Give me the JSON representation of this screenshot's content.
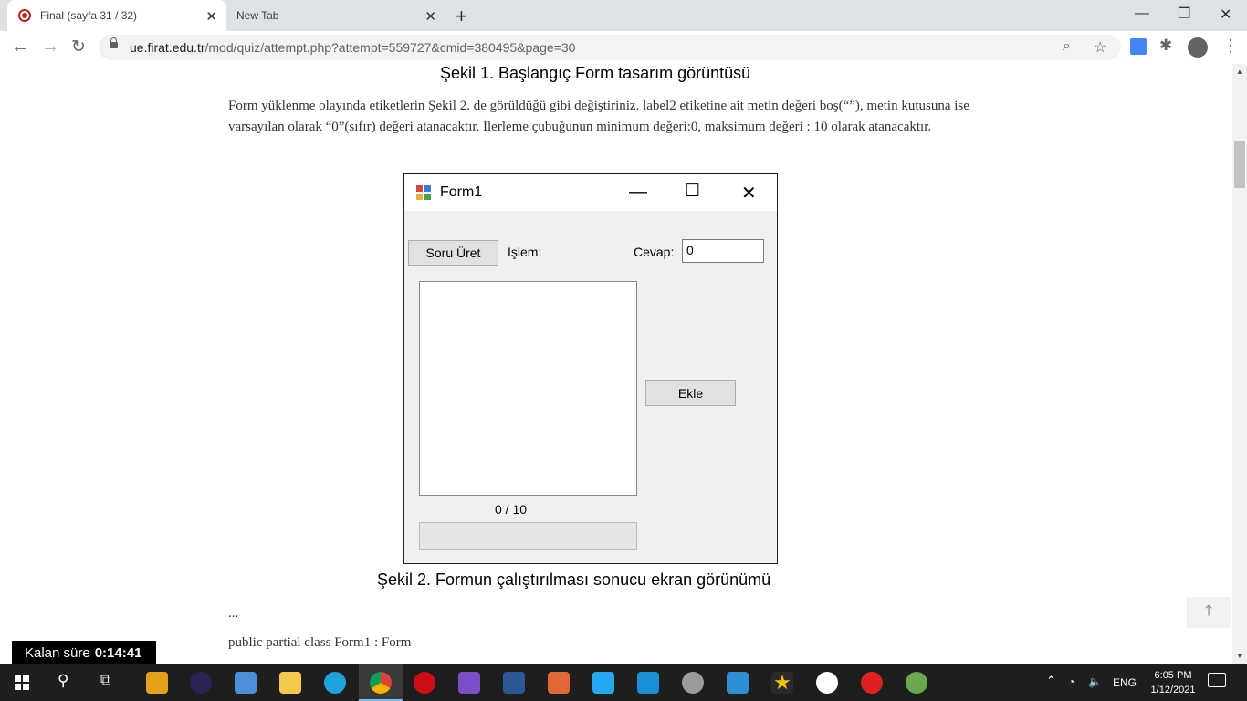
{
  "browser": {
    "tabs": [
      {
        "title": "Final (sayfa 31 / 32)",
        "active": true
      },
      {
        "title": "New Tab",
        "active": false
      }
    ],
    "url_host": "ue.firat.edu.tr",
    "url_path": "/mod/quiz/attempt.php?attempt=559727&cmid=380495&page=30"
  },
  "page": {
    "figure1_caption": "Şekil 1. Başlangıç Form tasarım görüntüsü",
    "paragraph": "Form yüklenme olayında etiketlerin Şekil 2. de görüldüğü gibi değiştiriniz. label2 etiketine ait metin değeri  boş(“”), metin kutusuna ise varsayılan olarak “0”(sıfır) değeri atanacaktır. İlerleme çubuğunun minimum değeri:0, maksimum değeri : 10 olarak atanacaktır.",
    "figure2_caption": "Şekil 2. Formun çalıştırılması sonucu ekran görünümü",
    "ellipsis": "...",
    "code_line": "public partial class Form1 : Form"
  },
  "form": {
    "title": "Form1",
    "soru_button": "Soru Üret",
    "islem_label": "İşlem:",
    "cevap_label": "Cevap:",
    "cevap_value": "0",
    "ekle_button": "Ekle",
    "counter": "0 / 10",
    "progress": 0
  },
  "timer": {
    "label": "Kalan süre",
    "value": "0:14:41"
  },
  "taskbar": {
    "language": "ENG",
    "time": "6:05 PM",
    "date": "1/12/2021"
  },
  "colors": {
    "tabstrip": "#dee1e6",
    "taskbar": "#1e1e1e",
    "accent": "#76b9ed"
  }
}
